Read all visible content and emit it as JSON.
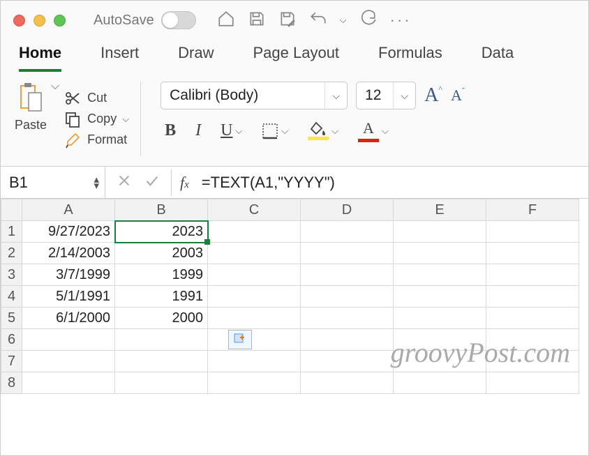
{
  "titlebar": {
    "autosave_label": "AutoSave"
  },
  "tabs": [
    "Home",
    "Insert",
    "Draw",
    "Page Layout",
    "Formulas",
    "Data"
  ],
  "active_tab": "Home",
  "ribbon": {
    "paste_label": "Paste",
    "cut_label": "Cut",
    "copy_label": "Copy",
    "format_label": "Format",
    "font_name": "Calibri (Body)",
    "font_size": "12"
  },
  "fxbar": {
    "namebox": "B1",
    "formula": "=TEXT(A1,\"YYYY\")"
  },
  "columns": [
    "A",
    "B",
    "C",
    "D",
    "E",
    "F"
  ],
  "rows": [
    {
      "n": "1",
      "A": "9/27/2023",
      "B": "2023"
    },
    {
      "n": "2",
      "A": "2/14/2003",
      "B": "2003"
    },
    {
      "n": "3",
      "A": "3/7/1999",
      "B": "1999"
    },
    {
      "n": "4",
      "A": "5/1/1991",
      "B": "1991"
    },
    {
      "n": "5",
      "A": "6/1/2000",
      "B": "2000"
    },
    {
      "n": "6",
      "A": "",
      "B": ""
    },
    {
      "n": "7",
      "A": "",
      "B": ""
    },
    {
      "n": "8",
      "A": "",
      "B": ""
    }
  ],
  "selected_cell": "B1",
  "watermark": "groovyPost.com"
}
